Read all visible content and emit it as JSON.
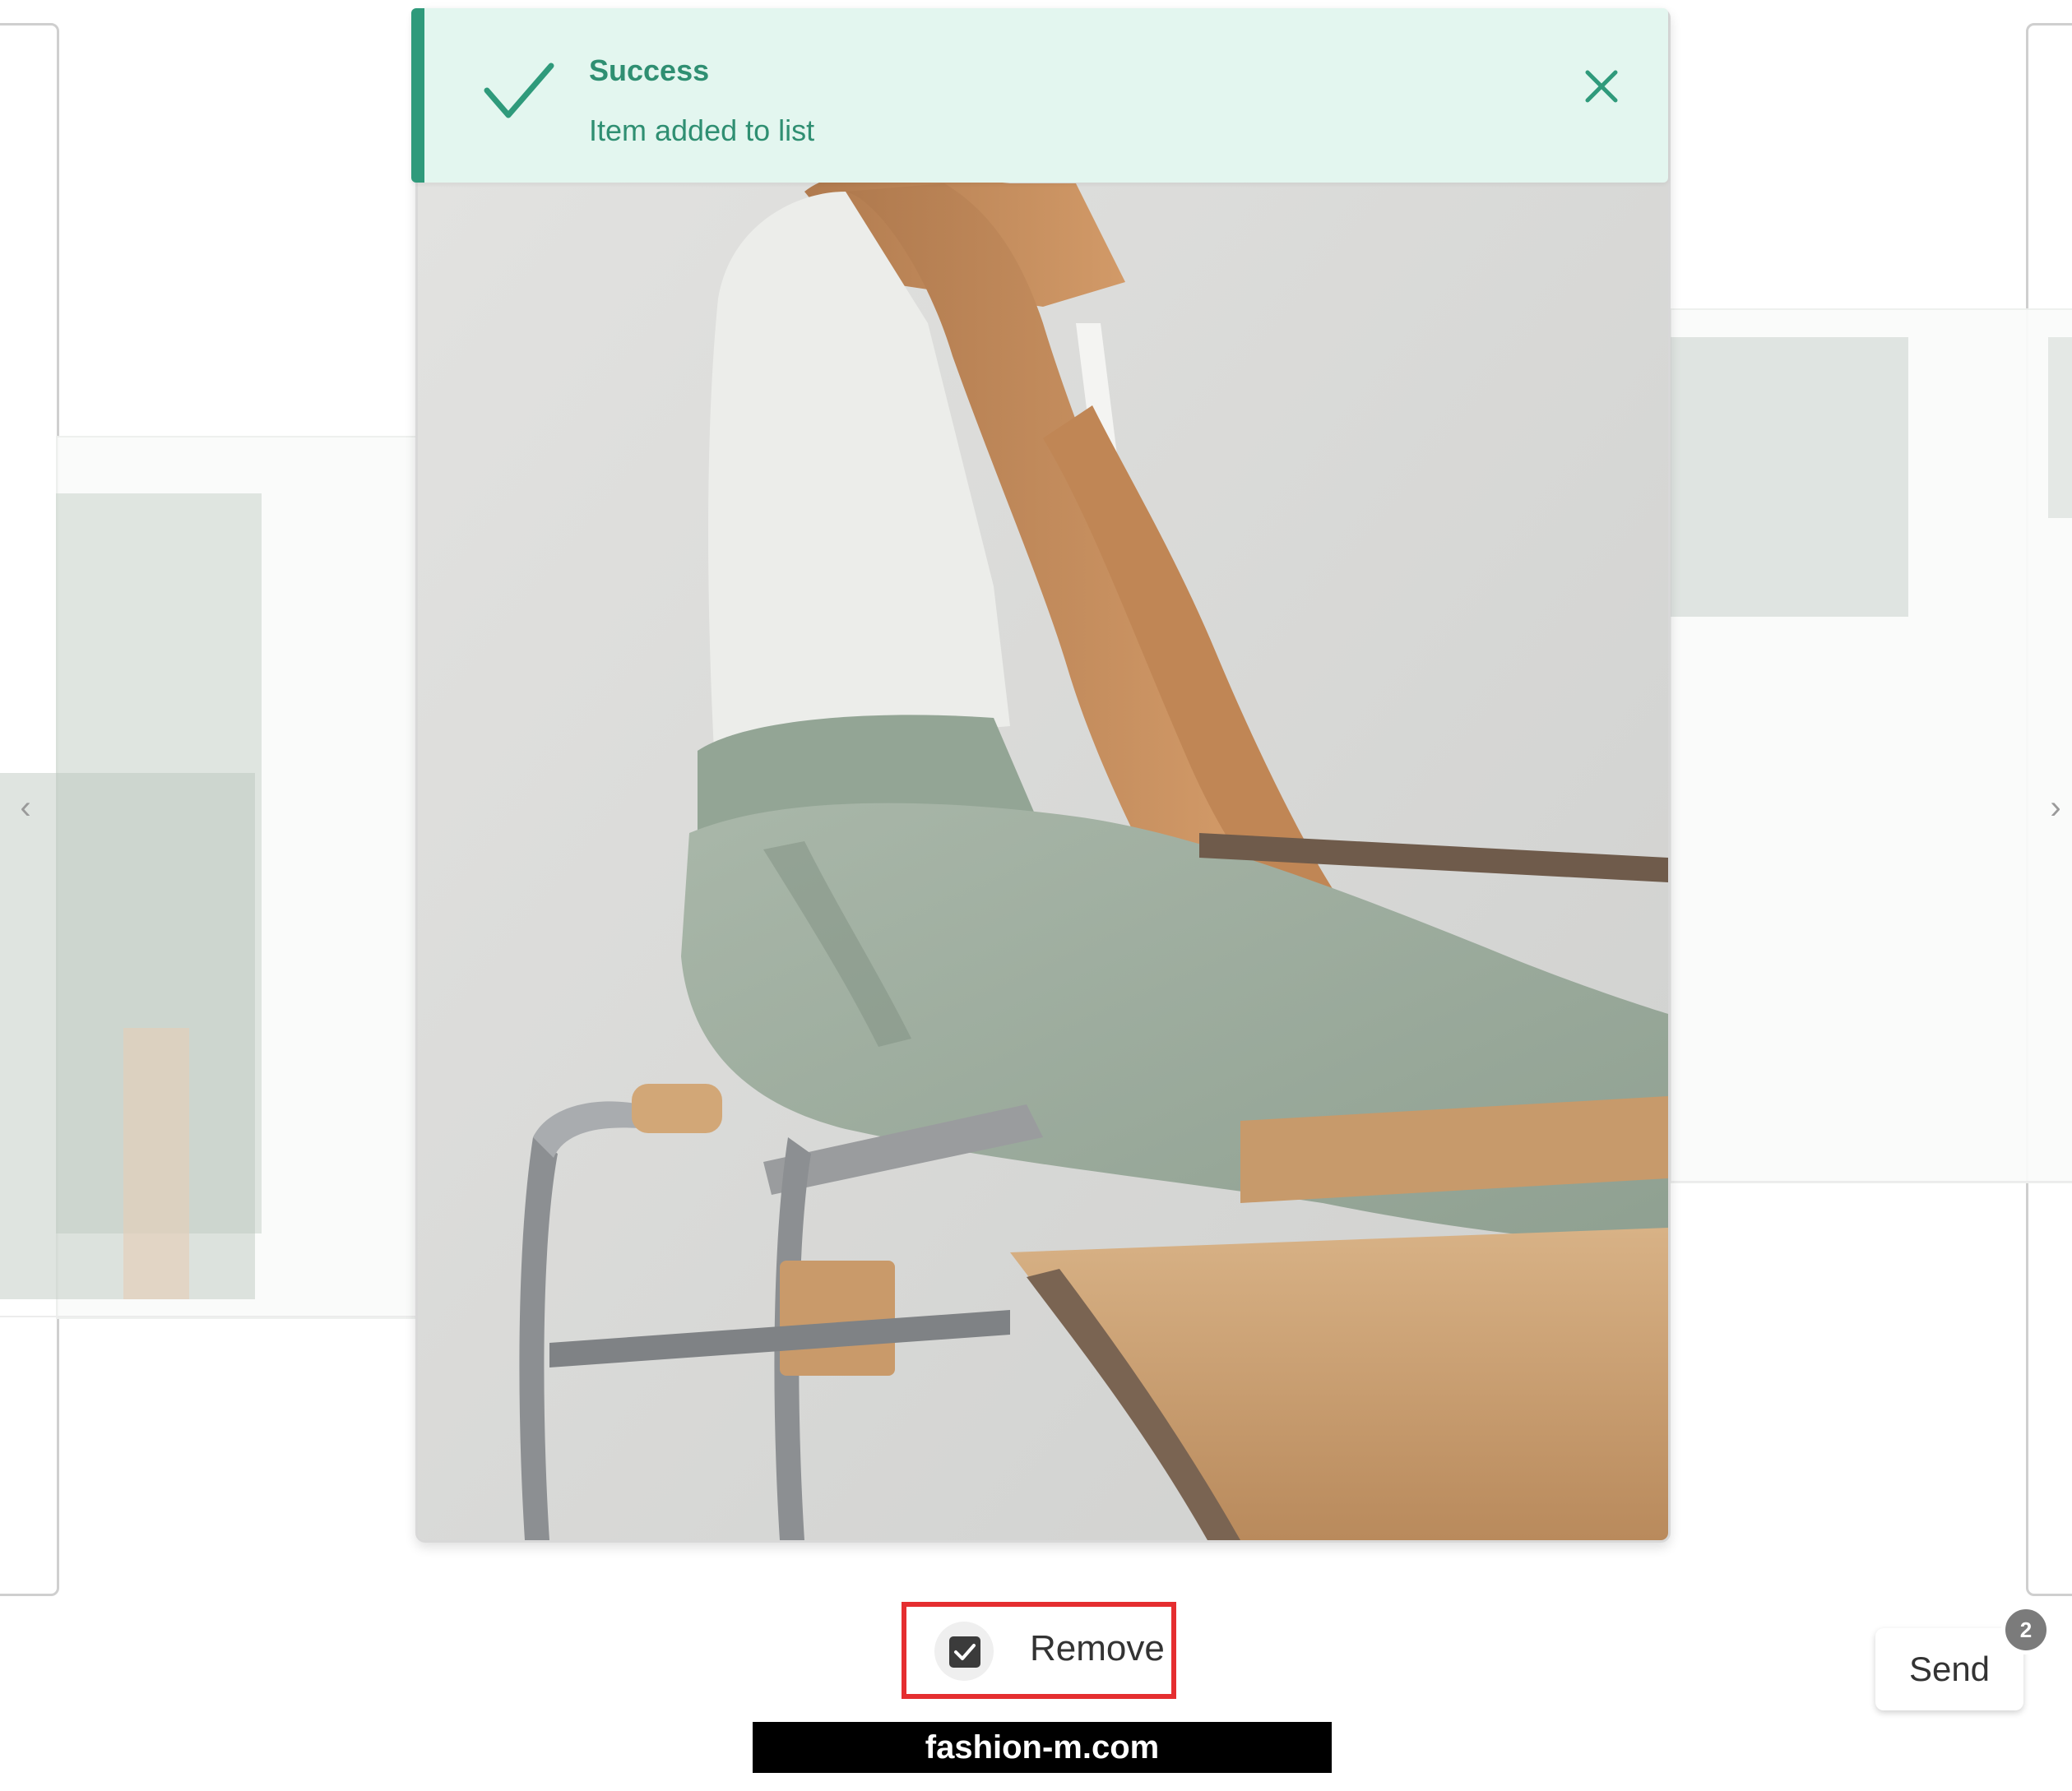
{
  "toast": {
    "title": "Success",
    "message": "Item added to list",
    "accent_color": "#2f9a7b",
    "background_color": "#e3f6ef",
    "icons": {
      "status": "check-icon",
      "close": "close-icon"
    }
  },
  "carousel": {
    "prev_label": "‹",
    "next_label": "›"
  },
  "product_image": {
    "subject": "model seated on chair wearing white tank top and sage green trousers"
  },
  "remove_control": {
    "label": "Remove",
    "checked": true,
    "highlight_color": "#e52e30"
  },
  "send_button": {
    "label": "Send",
    "badge_count": "2"
  },
  "watermark": {
    "text": "fashion-m.com"
  }
}
